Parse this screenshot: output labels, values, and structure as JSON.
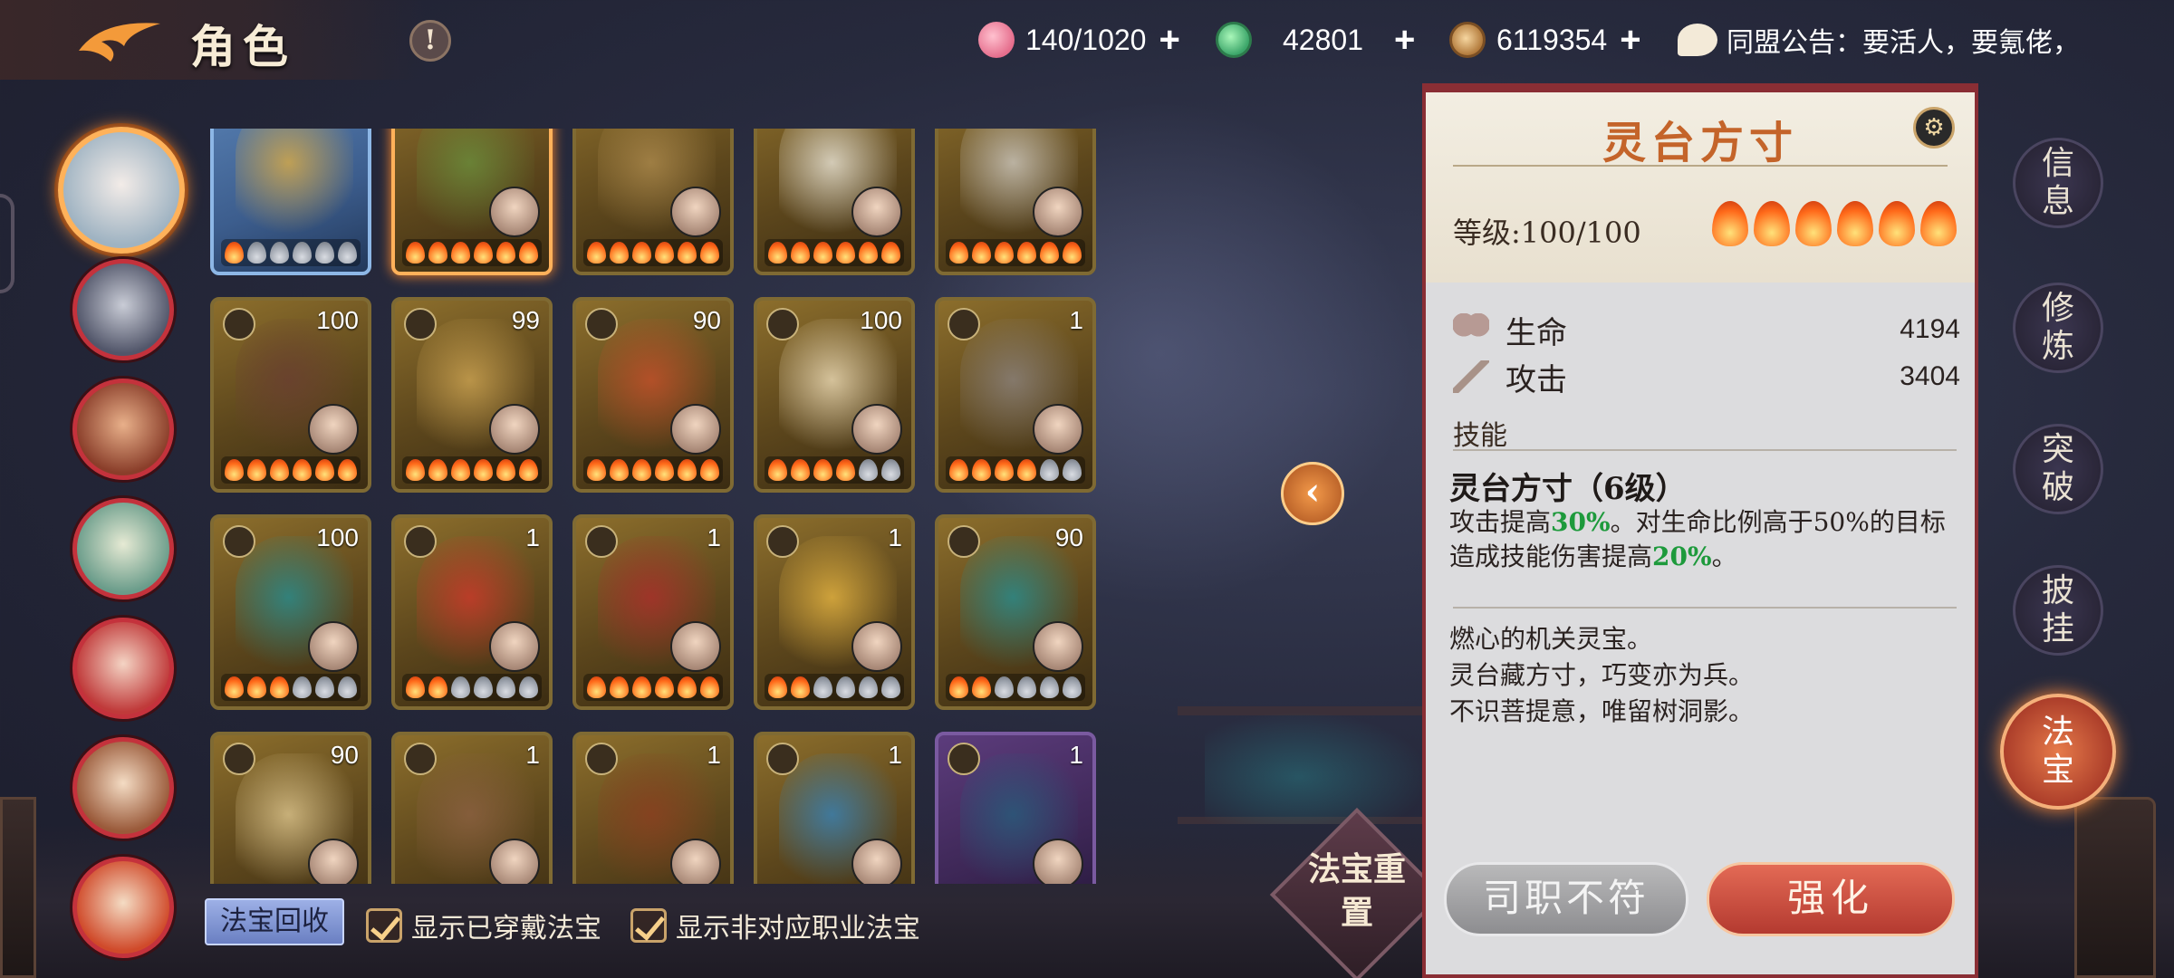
{
  "header": {
    "title": "角色",
    "info_label": "!",
    "resources": [
      {
        "icon": "peach-icon",
        "value": "140/1020"
      },
      {
        "icon": "jade-icon",
        "value": "42801"
      },
      {
        "icon": "coin-icon",
        "value": "6119354"
      }
    ],
    "plus_label": "+",
    "notice": "同盟公告：要活人，要氪佬，"
  },
  "avatars": [
    {
      "name": "character-1",
      "selected": true
    },
    {
      "name": "character-2"
    },
    {
      "name": "character-3"
    },
    {
      "name": "character-4"
    },
    {
      "name": "character-5"
    },
    {
      "name": "character-6"
    },
    {
      "name": "character-7"
    }
  ],
  "treasures": [
    {
      "level": "",
      "flames": 1,
      "style": "blue"
    },
    {
      "level": "",
      "flames": 6,
      "style": "sel"
    },
    {
      "level": "",
      "flames": 6
    },
    {
      "level": "",
      "flames": 6
    },
    {
      "level": "",
      "flames": 6
    },
    {
      "level": "100",
      "flames": 6
    },
    {
      "level": "99",
      "flames": 6
    },
    {
      "level": "90",
      "flames": 6
    },
    {
      "level": "100",
      "flames": 4
    },
    {
      "level": "1",
      "flames": 4
    },
    {
      "level": "100",
      "flames": 3
    },
    {
      "level": "1",
      "flames": 2
    },
    {
      "level": "1",
      "flames": 6
    },
    {
      "level": "1",
      "flames": 2
    },
    {
      "level": "90",
      "flames": 2
    },
    {
      "level": "90",
      "flames": 0
    },
    {
      "level": "1",
      "flames": 0
    },
    {
      "level": "1",
      "flames": 0
    },
    {
      "level": "1",
      "flames": 0
    },
    {
      "level": "1",
      "flames": 0,
      "style": "purple"
    }
  ],
  "controls": {
    "recycle": "法宝回收",
    "show_equipped": "显示已穿戴法宝",
    "show_other_class": "显示非对应职业法宝",
    "reset": "法宝重置",
    "collapse": "‹"
  },
  "detail": {
    "title": "灵台方寸",
    "level": "等级:100/100",
    "stars": 6,
    "stats": [
      {
        "label": "生命",
        "value": "4194"
      },
      {
        "label": "攻击",
        "value": "3404"
      }
    ],
    "skill_section": "技能",
    "skill_name": "灵台方寸（6级）",
    "skill_desc_1": "攻击提高",
    "skill_val_1": "30%",
    "skill_desc_2": "。对生命比例高于50%的目标造成技能伤害提高",
    "skill_val_2": "20%",
    "skill_desc_3": "。",
    "flavor": [
      "燃心的机关灵宝。",
      "灵台藏方寸，巧变亦为兵。",
      "不识菩提意，唯留树洞影。"
    ],
    "btn_mismatch": "司职不符",
    "btn_enhance": "强化"
  },
  "tabs": [
    "信息",
    "修炼",
    "突破",
    "披挂",
    "法宝"
  ],
  "active_tab": 4,
  "colors": {
    "accent": "#c4642a",
    "panel_border": "#8a2e34",
    "green": "#1e9a3c"
  }
}
